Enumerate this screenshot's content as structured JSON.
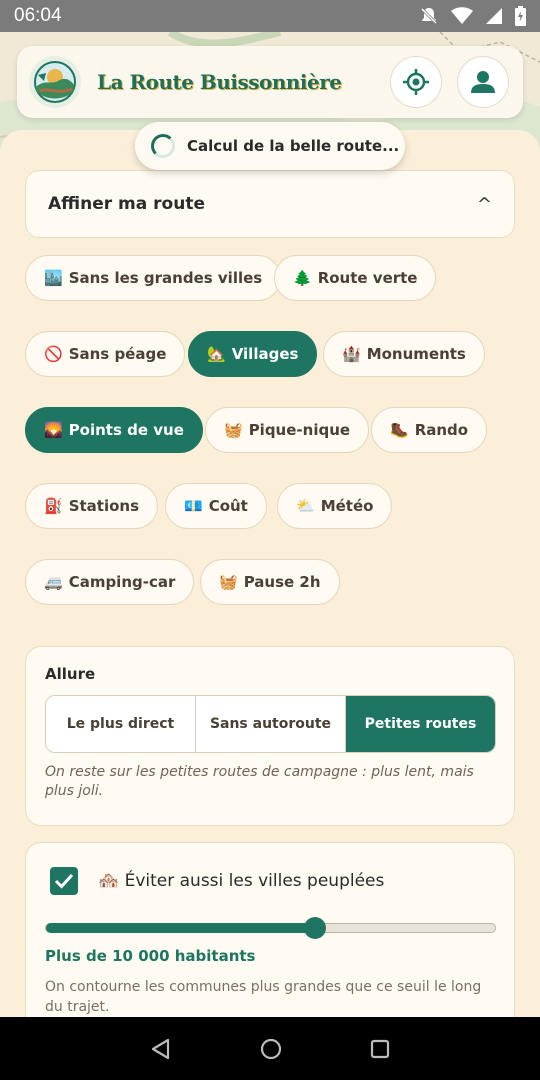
{
  "status_bar": {
    "time": "06:04"
  },
  "header": {
    "title": "La Route Buissonnière"
  },
  "toast": {
    "text": "Calcul de la belle route..."
  },
  "refine": {
    "title": "Affiner ma route",
    "caret": "^"
  },
  "chips": [
    {
      "emoji": "🏙️",
      "label": "Sans les grandes villes",
      "active": false
    },
    {
      "emoji": "🌲",
      "label": "Route verte",
      "active": false
    },
    {
      "emoji": "🚫",
      "label": "Sans péage",
      "active": false
    },
    {
      "emoji": "🏡",
      "label": "Villages",
      "active": true
    },
    {
      "emoji": "🏰",
      "label": "Monuments",
      "active": false
    },
    {
      "emoji": "🌄",
      "label": "Points de vue",
      "active": true
    },
    {
      "emoji": "🧺",
      "label": "Pique-nique",
      "active": false
    },
    {
      "emoji": "🥾",
      "label": "Rando",
      "active": false
    },
    {
      "emoji": "⛽",
      "label": "Stations",
      "active": false
    },
    {
      "emoji": "💶",
      "label": "Coût",
      "active": false
    },
    {
      "emoji": "⛅",
      "label": "Météo",
      "active": false
    },
    {
      "emoji": "🚐",
      "label": "Camping-car",
      "active": false
    },
    {
      "emoji": "🧺",
      "label": "Pause 2h",
      "active": false
    }
  ],
  "allure": {
    "label": "Allure",
    "options": [
      "Le plus direct",
      "Sans autoroute",
      "Petites routes"
    ],
    "selected": "Petites routes",
    "description": "On reste sur les petites routes de campagne : plus lent, mais plus joli."
  },
  "avoid_cities": {
    "checked": true,
    "emoji": "🏘️",
    "label": "Éviter aussi les villes peuplées",
    "slider_fraction": 0.6,
    "value_label": "Plus de 10 000 habitants",
    "description": "On contourne les communes plus grandes que ce seuil le long du trajet."
  },
  "colors": {
    "primary": "#1e7561",
    "sheet": "#fbefd9",
    "accent": "#e8b64c"
  }
}
